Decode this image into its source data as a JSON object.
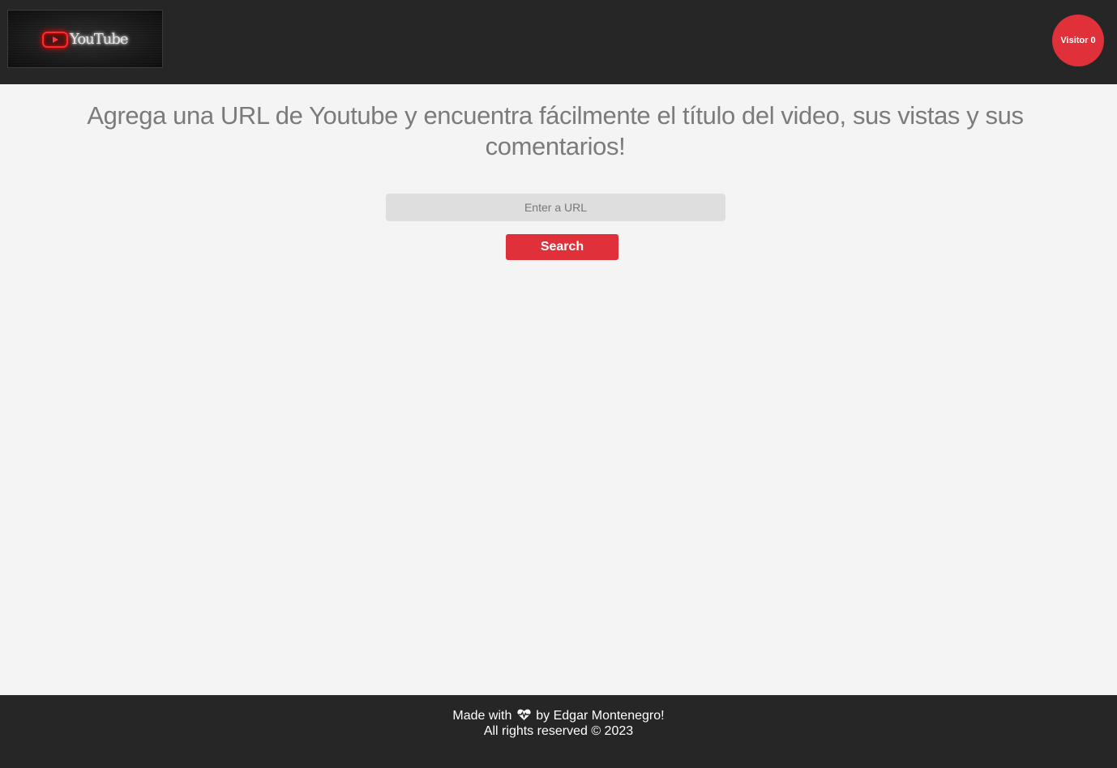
{
  "header": {
    "logo_text": "YouTube",
    "visitor_badge": "Visitor 0"
  },
  "main": {
    "headline": "Agrega una URL de Youtube y encuentra fácilmente el título del video, sus vistas y sus comentarios!",
    "url_placeholder": "Enter a URL",
    "search_label": "Search"
  },
  "footer": {
    "made_with": "Made with",
    "by_author": "by Edgar Montenegro!",
    "rights": "All rights reserved © 2023",
    "icon": "heart-pulse-icon"
  },
  "colors": {
    "header_bg": "#262626",
    "page_bg": "#f4f4f4",
    "accent": "#e0303a",
    "input_bg": "#dedede",
    "headline_text": "#7b7b7b"
  }
}
